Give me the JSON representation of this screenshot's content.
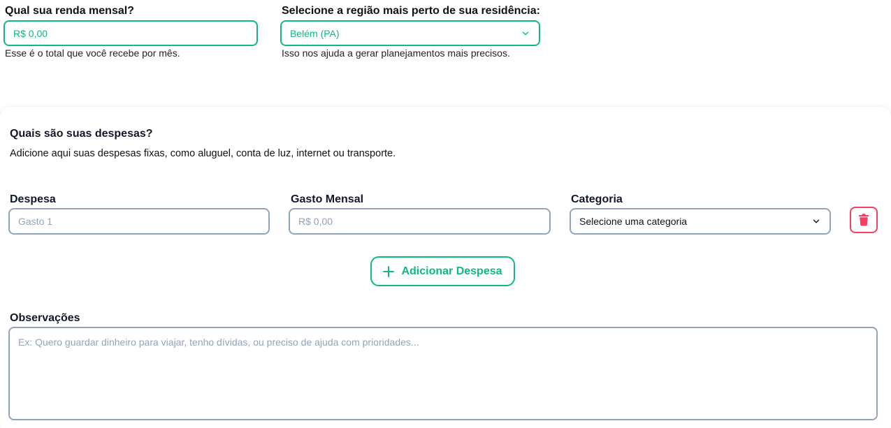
{
  "income": {
    "label": "Qual sua renda mensal?",
    "value": "R$ 0,00",
    "hint": "Esse é o total que você recebe por mês."
  },
  "region": {
    "label": "Selecione a região mais perto de sua residência:",
    "selected": "Belém (PA)",
    "hint": "Isso nos ajuda a gerar planejamentos mais precisos."
  },
  "expenses": {
    "title": "Quais são suas despesas?",
    "description": "Adicione aqui suas despesas fixas, como aluguel, conta de luz, internet ou transporte.",
    "columns": {
      "expense": "Despesa",
      "monthly": "Gasto Mensal",
      "category": "Categoria"
    },
    "row": {
      "expense_placeholder": "Gasto 1",
      "monthly_placeholder": "R$ 0,00",
      "category_selected": "Selecione uma categoria"
    },
    "add_label": "Adicionar Despesa"
  },
  "notes": {
    "label": "Observações",
    "placeholder": "Ex: Quero guardar dinheiro para viajar, tenho dívidas, ou preciso de ajuda com prioridades..."
  },
  "colors": {
    "accent": "#10b981",
    "danger": "#f43f5e",
    "border": "#94a3b8"
  }
}
